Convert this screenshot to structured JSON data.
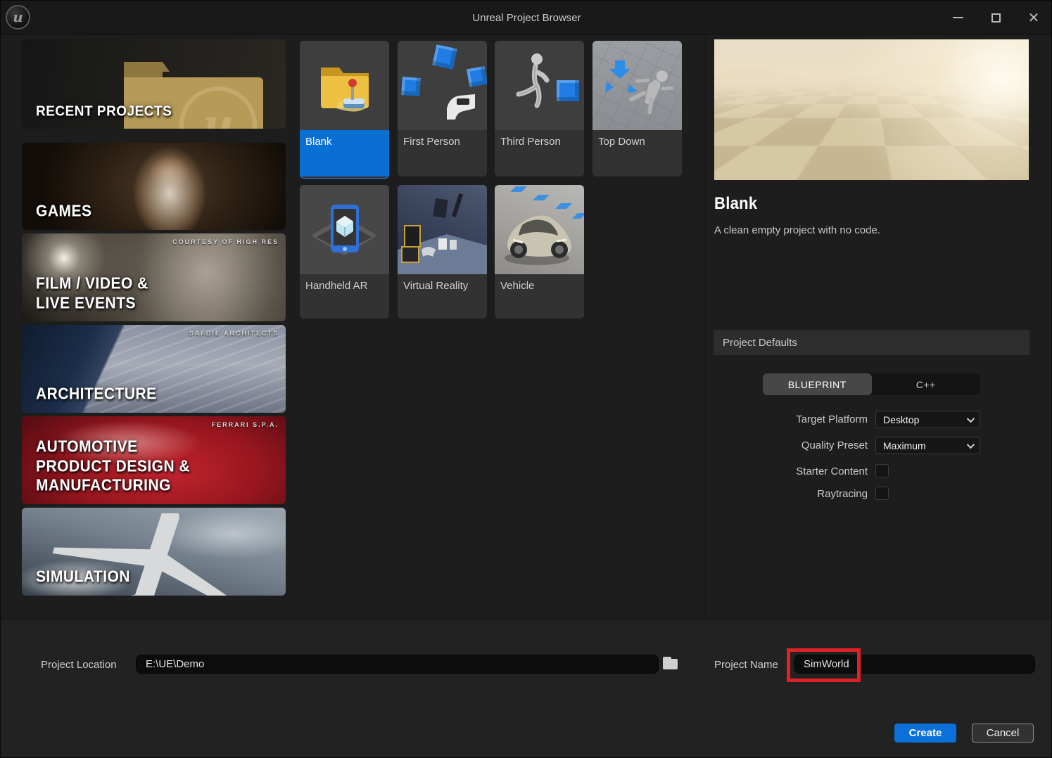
{
  "window": {
    "title": "Unreal Project Browser"
  },
  "titlebar": {
    "logo": "u",
    "minimize_icon": "–",
    "maximize_icon": "square-outline",
    "close_icon": "✕"
  },
  "categories": [
    {
      "label": "RECENT PROJECTS",
      "selected": false,
      "credit": ""
    },
    {
      "label": "GAMES",
      "selected": true,
      "credit": ""
    },
    {
      "label": "FILM / VIDEO &\nLIVE EVENTS",
      "selected": false,
      "credit": "COURTESY OF HIGH RES"
    },
    {
      "label": "ARCHITECTURE",
      "selected": false,
      "credit": "SAFDIE ARCHITECTS"
    },
    {
      "label": "AUTOMOTIVE\nPRODUCT DESIGN &\nMANUFACTURING",
      "selected": false,
      "credit": "FERRARI S.P.A."
    },
    {
      "label": "SIMULATION",
      "selected": false,
      "credit": ""
    }
  ],
  "templates": [
    {
      "label": "Blank",
      "selected": true
    },
    {
      "label": "First Person",
      "selected": false
    },
    {
      "label": "Third Person",
      "selected": false
    },
    {
      "label": "Top Down",
      "selected": false
    },
    {
      "label": "Handheld AR",
      "selected": false
    },
    {
      "label": "Virtual Reality",
      "selected": false
    },
    {
      "label": "Vehicle",
      "selected": false
    }
  ],
  "details": {
    "title": "Blank",
    "description": "A clean empty project with no code.",
    "section_title": "Project Defaults",
    "toggle": {
      "options": [
        "BLUEPRINT",
        "C++"
      ],
      "selected": "BLUEPRINT"
    },
    "fields": [
      {
        "label": "Target Platform",
        "type": "dropdown",
        "value": "Desktop"
      },
      {
        "label": "Quality Preset",
        "type": "dropdown",
        "value": "Maximum"
      },
      {
        "label": "Starter Content",
        "type": "checkbox",
        "checked": false
      },
      {
        "label": "Raytracing",
        "type": "checkbox",
        "checked": false
      }
    ]
  },
  "footer": {
    "location_label": "Project Location",
    "location_value": "E:\\UE\\Demo",
    "name_label": "Project Name",
    "name_value": "SimWorld",
    "create_label": "Create",
    "cancel_label": "Cancel"
  },
  "colors": {
    "accent_blue": "#0b70d8",
    "selection_border": "#2f7fe0",
    "annotation_red": "#dd2127"
  }
}
